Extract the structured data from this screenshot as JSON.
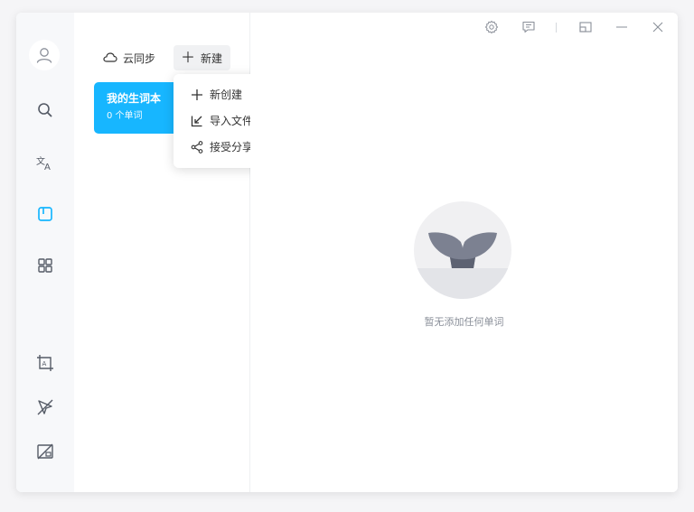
{
  "sidebar": {
    "items": [
      {
        "icon": "avatar-icon"
      },
      {
        "icon": "search-icon"
      },
      {
        "icon": "translate-icon"
      },
      {
        "icon": "wordbook-icon",
        "active": true
      },
      {
        "icon": "apps-grid-icon"
      },
      {
        "icon": "screenshot-translate-icon"
      },
      {
        "icon": "select-translate-off-icon"
      },
      {
        "icon": "clipboard-translate-off-icon"
      }
    ],
    "active_color": "#17b6ff"
  },
  "toolbar": {
    "sync_label": "云同步",
    "new_label": "新建"
  },
  "wordbook": {
    "title": "我的生词本",
    "count": "0 个单词"
  },
  "dropdown": {
    "items": [
      {
        "label": "新创建",
        "icon": "plus-icon"
      },
      {
        "label": "导入文件",
        "icon": "import-icon"
      },
      {
        "label": "接受分享",
        "icon": "share-icon"
      }
    ]
  },
  "titlebar": {
    "icons": [
      "settings-icon",
      "feedback-icon",
      "mini-window-icon",
      "minimize-icon",
      "close-icon"
    ]
  },
  "main": {
    "empty_text": "暂无添加任何单词"
  }
}
